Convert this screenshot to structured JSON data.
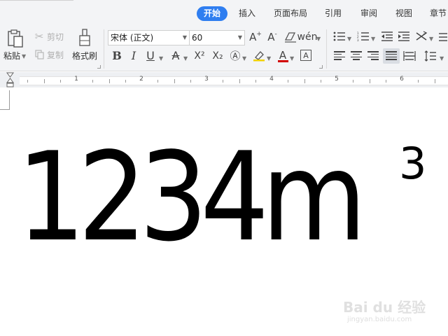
{
  "menu": {
    "tabs": [
      "开始",
      "插入",
      "页面布局",
      "引用",
      "审阅",
      "视图",
      "章节"
    ],
    "active_tab": "开始"
  },
  "ribbon": {
    "paste_label": "粘贴",
    "cut_label": "剪切",
    "copy_label": "复制",
    "format_painter_label": "格式刷",
    "font_name": "宋体 (正文)",
    "font_size": "60",
    "superscript_glyph": "X²",
    "subscript_glyph": "X₂"
  },
  "ruler": {
    "numbers": [
      "1",
      "2",
      "3",
      "4",
      "5",
      "6"
    ]
  },
  "document": {
    "main_text": "1234m",
    "superscript_text": "3"
  },
  "watermark": {
    "text": "Bai du 经验",
    "url": "jingyan.baidu.com"
  }
}
